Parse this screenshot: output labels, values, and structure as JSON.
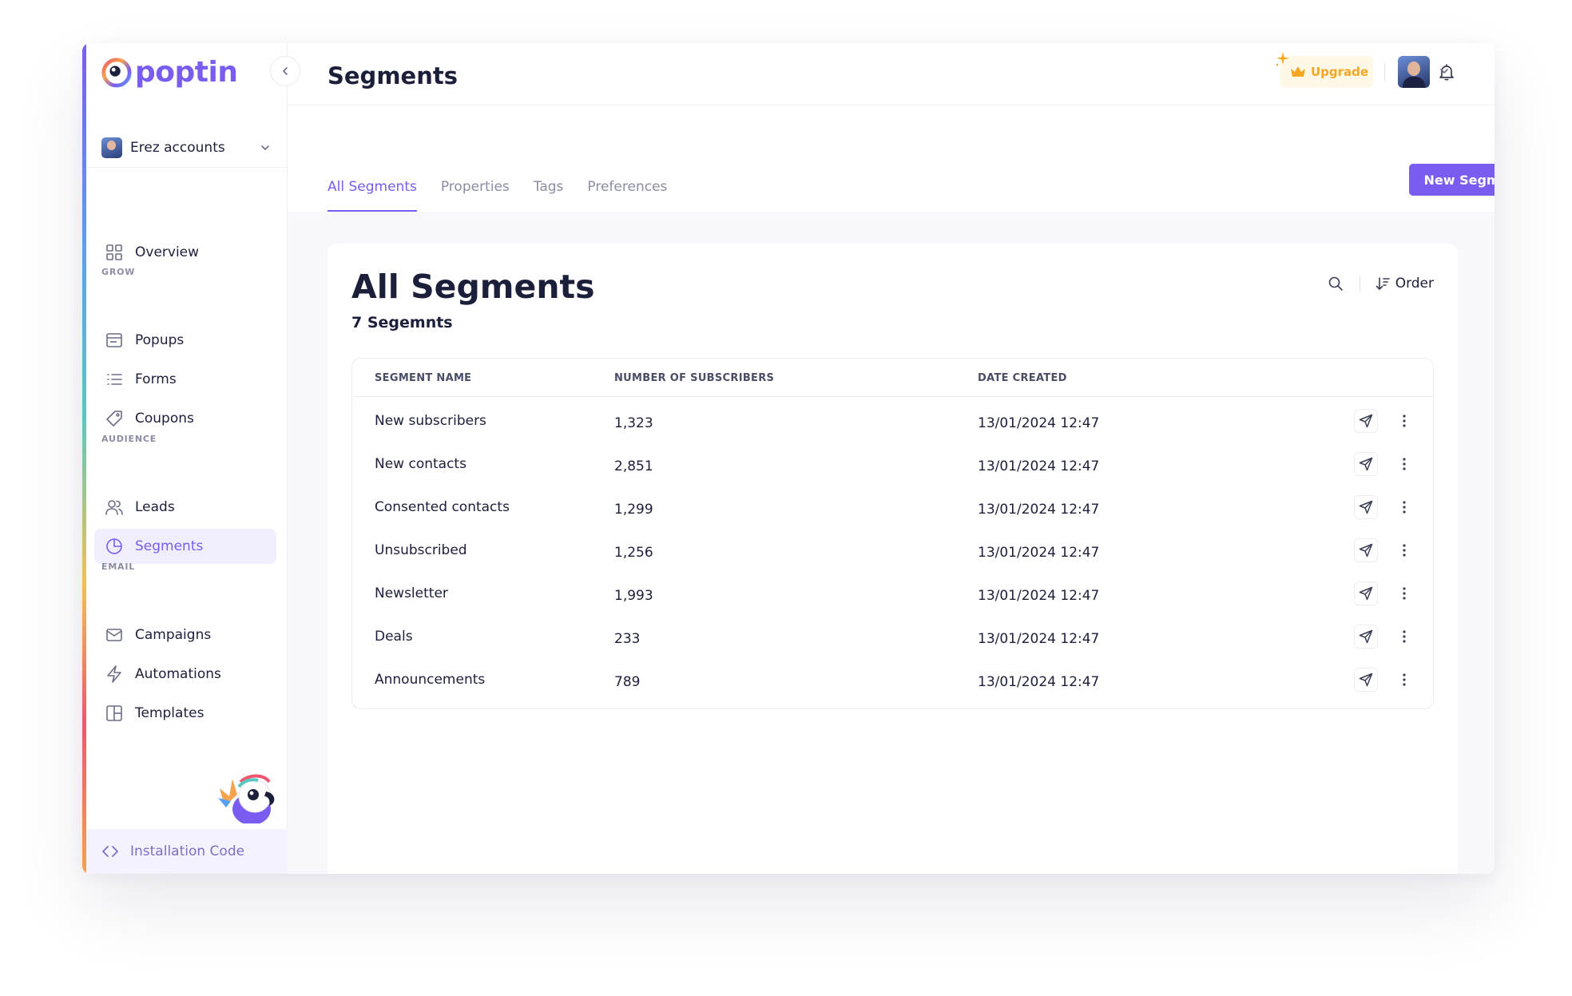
{
  "brand": {
    "name": "poptin",
    "accent": "#7b5cf0"
  },
  "account": {
    "name": "Erez accounts"
  },
  "sidebar": {
    "overview": "Overview",
    "sections": {
      "grow": "GROW",
      "audience": "AUDIENCE",
      "email": "EMAIL"
    },
    "items": [
      {
        "label": "Popups",
        "icon": "popup-icon"
      },
      {
        "label": "Forms",
        "icon": "list-icon"
      },
      {
        "label": "Coupons",
        "icon": "tag-icon"
      },
      {
        "label": "Leads",
        "icon": "users-icon"
      },
      {
        "label": "Segments",
        "icon": "pie-icon",
        "active": true
      },
      {
        "label": "Campaigns",
        "icon": "mail-icon"
      },
      {
        "label": "Automations",
        "icon": "bolt-icon"
      },
      {
        "label": "Templates",
        "icon": "layout-icon"
      }
    ],
    "install": "Installation Code"
  },
  "header": {
    "title": "Segments",
    "upgrade": "Upgrade"
  },
  "tabs": [
    {
      "label": "All Segments",
      "active": true
    },
    {
      "label": "Properties"
    },
    {
      "label": "Tags"
    },
    {
      "label": "Preferences"
    }
  ],
  "new_segment_label": "New Segment",
  "card": {
    "title": "All Segments",
    "subtitle": "7 Segemnts",
    "order_label": "Order"
  },
  "table": {
    "columns": [
      "SEGMENT NAME",
      "NUMBER OF SUBSCRIBERS",
      "DATE CREATED"
    ],
    "rows": [
      {
        "name": "New subscribers",
        "count": "1,323",
        "date": "13/01/2024 12:47"
      },
      {
        "name": "New contacts",
        "count": "2,851",
        "date": "13/01/2024 12:47"
      },
      {
        "name": "Consented contacts",
        "count": "1,299",
        "date": "13/01/2024 12:47"
      },
      {
        "name": "Unsubscribed",
        "count": "1,256",
        "date": "13/01/2024 12:47"
      },
      {
        "name": "Newsletter",
        "count": "1,993",
        "date": "13/01/2024 12:47"
      },
      {
        "name": "Deals",
        "count": "233",
        "date": "13/01/2024 12:47"
      },
      {
        "name": "Announcements",
        "count": "789",
        "date": "13/01/2024 12:47"
      }
    ]
  }
}
